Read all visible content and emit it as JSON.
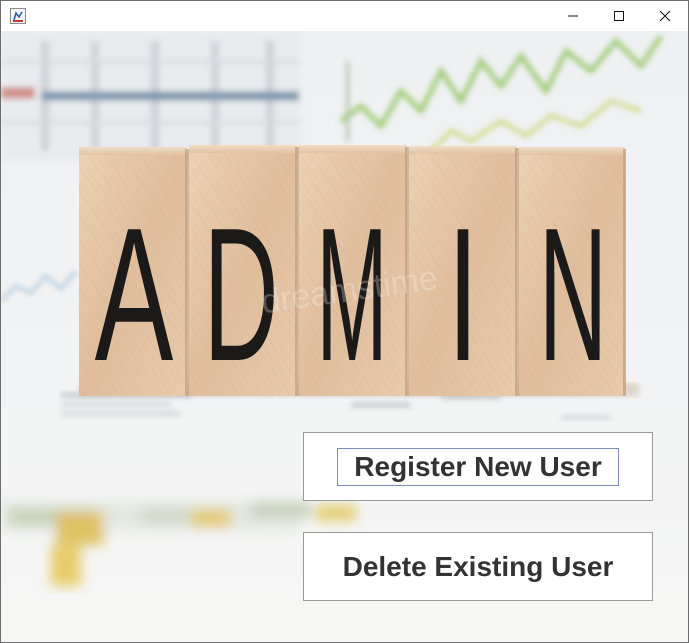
{
  "window": {
    "title": "",
    "icon": "java-cup-icon",
    "controls": [
      "minimize-icon",
      "maximize-icon",
      "close-icon"
    ]
  },
  "banner": {
    "letters": [
      "A",
      "D",
      "M",
      "I",
      "N"
    ],
    "watermark": "dreamstime"
  },
  "actions": {
    "register_label": "Register New User",
    "delete_label": "Delete Existing User"
  },
  "colors": {
    "block_wood": "#e3c4a6",
    "letter": "#1c1a18",
    "button_border": "#9a9a9a",
    "button_text": "#333333",
    "focus_ring": "#7a8db0"
  }
}
